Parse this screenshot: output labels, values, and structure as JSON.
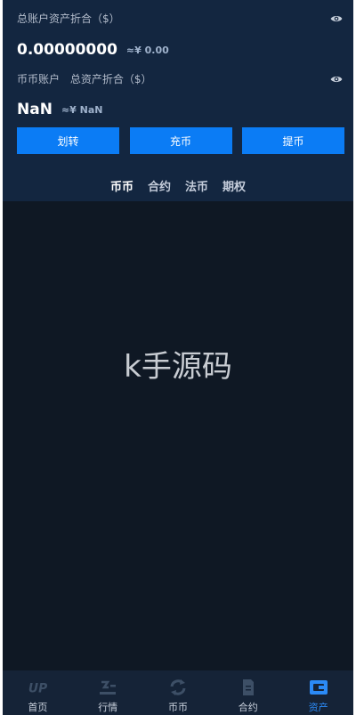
{
  "total": {
    "label": "总账户资产折合（$）",
    "value": "0.00000000",
    "approx": "≈¥ 0.00"
  },
  "coin_account": {
    "label": "币币账户",
    "sub_label": "总资产折合（$）",
    "value": "NaN",
    "approx": "≈¥ NaN"
  },
  "actions": {
    "transfer": "划转",
    "deposit": "充币",
    "withdraw": "提币"
  },
  "tabs": [
    {
      "label": "币币",
      "active": true
    },
    {
      "label": "合约",
      "active": false
    },
    {
      "label": "法币",
      "active": false
    },
    {
      "label": "期权",
      "active": false
    }
  ],
  "watermark": "k手源码",
  "bottom_nav": [
    {
      "label": "首页",
      "icon": "up-logo-icon",
      "active": false
    },
    {
      "label": "行情",
      "icon": "market-icon",
      "active": false
    },
    {
      "label": "币币",
      "icon": "swap-icon",
      "active": false
    },
    {
      "label": "合约",
      "icon": "contract-icon",
      "active": false
    },
    {
      "label": "资产",
      "icon": "wallet-icon",
      "active": true
    }
  ],
  "colors": {
    "accent": "#0b7cf5",
    "header_bg": "#132640",
    "body_bg": "#0f1824",
    "nav_bg": "#152337",
    "active_nav": "#2b8af6"
  }
}
